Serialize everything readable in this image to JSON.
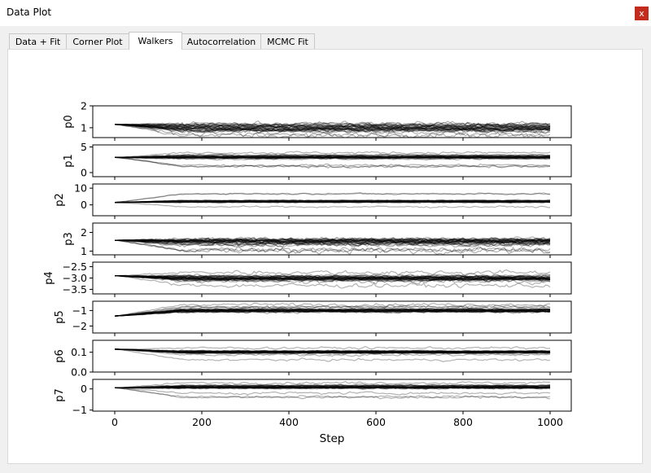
{
  "window": {
    "title": "Data Plot",
    "close_label": "x"
  },
  "tabs": [
    {
      "label": "Data + Fit",
      "active": false
    },
    {
      "label": "Corner Plot",
      "active": false
    },
    {
      "label": "Walkers",
      "active": true
    },
    {
      "label": "Autocorrelation",
      "active": false
    },
    {
      "label": "MCMC Fit",
      "active": false
    }
  ],
  "chart_data": {
    "type": "line",
    "description_free": true,
    "xlabel": "Step",
    "xlim": [
      0,
      1000
    ],
    "x_ticks": [
      0,
      200,
      400,
      600,
      800,
      1000
    ],
    "x_tick_labels": [
      "0",
      "200",
      "400",
      "600",
      "800",
      "1000"
    ],
    "line_color": "#000000",
    "series_opacity": 0.3,
    "panels": [
      {
        "ylabel": "p0",
        "ylim": [
          0.55,
          2.0
        ],
        "yticks": [
          1,
          2
        ],
        "ytick_labels": [
          "1",
          "2"
        ],
        "start": 1.15,
        "center": 1.0,
        "spread": 0.25,
        "outlier_spread": 0.4
      },
      {
        "ylabel": "p1",
        "ylim": [
          -0.8,
          5.4
        ],
        "yticks": [
          0,
          5
        ],
        "ytick_labels": [
          "0",
          "5"
        ],
        "start": 2.95,
        "center": 3.0,
        "spread": 0.5,
        "outlier_spread": 2.0
      },
      {
        "ylabel": "p2",
        "ylim": [
          -6.5,
          12.5
        ],
        "yticks": [
          0,
          10
        ],
        "ytick_labels": [
          "0",
          "10"
        ],
        "start": 1.5,
        "center": 2.0,
        "spread": 1.0,
        "outlier_spread": 5.0
      },
      {
        "ylabel": "p3",
        "ylim": [
          0.8,
          2.5
        ],
        "yticks": [
          1,
          2
        ],
        "ytick_labels": [
          "1",
          "2"
        ],
        "start": 1.58,
        "center": 1.5,
        "spread": 0.3,
        "outlier_spread": 0.5
      },
      {
        "ylabel": "p4",
        "ylim": [
          -3.7,
          -2.3
        ],
        "yticks": [
          -2.5,
          -3.0,
          -3.5
        ],
        "ytick_labels": [
          "−2.5",
          "−3.0",
          "−3.5"
        ],
        "start": -2.9,
        "center": -3.0,
        "spread": 0.2,
        "outlier_spread": 0.35
      },
      {
        "ylabel": "p5",
        "ylim": [
          -2.45,
          -0.4
        ],
        "yticks": [
          -1,
          -2
        ],
        "ytick_labels": [
          "−1",
          "−2"
        ],
        "start": -1.35,
        "center": -1.0,
        "spread": 0.2,
        "outlier_spread": 0.45
      },
      {
        "ylabel": "p6",
        "ylim": [
          0.0,
          0.16
        ],
        "yticks": [
          0.1,
          0.0
        ],
        "ytick_labels": [
          "0.1",
          "0.0"
        ],
        "start": 0.115,
        "center": 0.1,
        "spread": 0.012,
        "outlier_spread": 0.04
      },
      {
        "ylabel": "p7",
        "ylim": [
          -1.05,
          0.45
        ],
        "yticks": [
          0,
          -1
        ],
        "ytick_labels": [
          "0",
          "−1"
        ],
        "start": 0.05,
        "center": 0.1,
        "spread": 0.12,
        "outlier_spread": 0.5
      }
    ]
  }
}
